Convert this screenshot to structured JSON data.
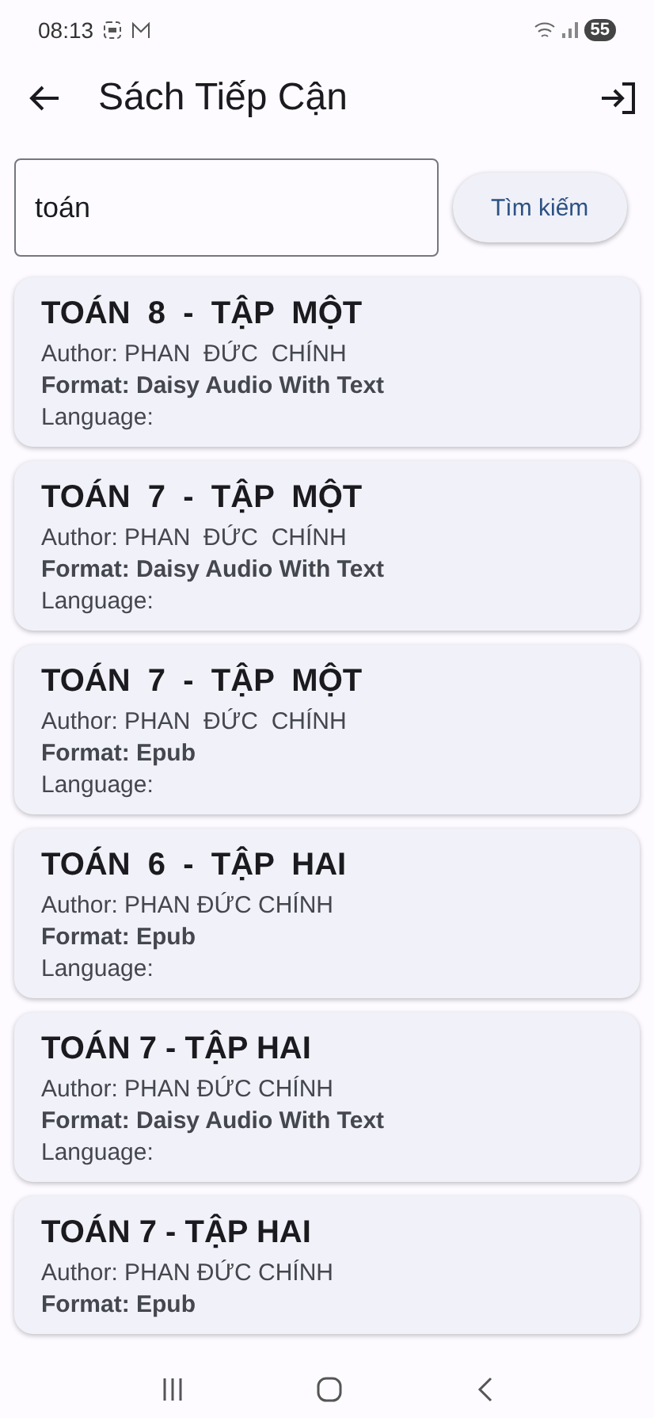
{
  "status_bar": {
    "time": "08:13",
    "battery": "55"
  },
  "app_bar": {
    "title": "Sách Tiếp Cận"
  },
  "search": {
    "value": "toán",
    "button": "Tìm kiếm"
  },
  "books": [
    {
      "title": "TOÁN  8  -  TẬP  MỘT",
      "author": "Author: PHAN  ĐỨC  CHÍNH",
      "format": "Format: Daisy Audio With Text",
      "language": "Language:"
    },
    {
      "title": "TOÁN  7  -  TẬP  MỘT",
      "author": "Author: PHAN  ĐỨC  CHÍNH",
      "format": "Format: Daisy Audio With Text",
      "language": "Language:"
    },
    {
      "title": "TOÁN  7  -  TẬP  MỘT",
      "author": "Author: PHAN  ĐỨC  CHÍNH",
      "format": "Format: Epub",
      "language": "Language:"
    },
    {
      "title": "TOÁN  6  -  TẬP  HAI",
      "author": "Author: PHAN ĐỨC CHÍNH",
      "format": "Format: Epub",
      "language": "Language:"
    },
    {
      "title": "TOÁN 7 - TẬP HAI",
      "author": "Author: PHAN ĐỨC CHÍNH",
      "format": "Format: Daisy Audio With Text",
      "language": "Language:"
    },
    {
      "title": "TOÁN 7 - TẬP HAI",
      "author": "Author: PHAN ĐỨC CHÍNH",
      "format": "Format: Epub"
    }
  ]
}
